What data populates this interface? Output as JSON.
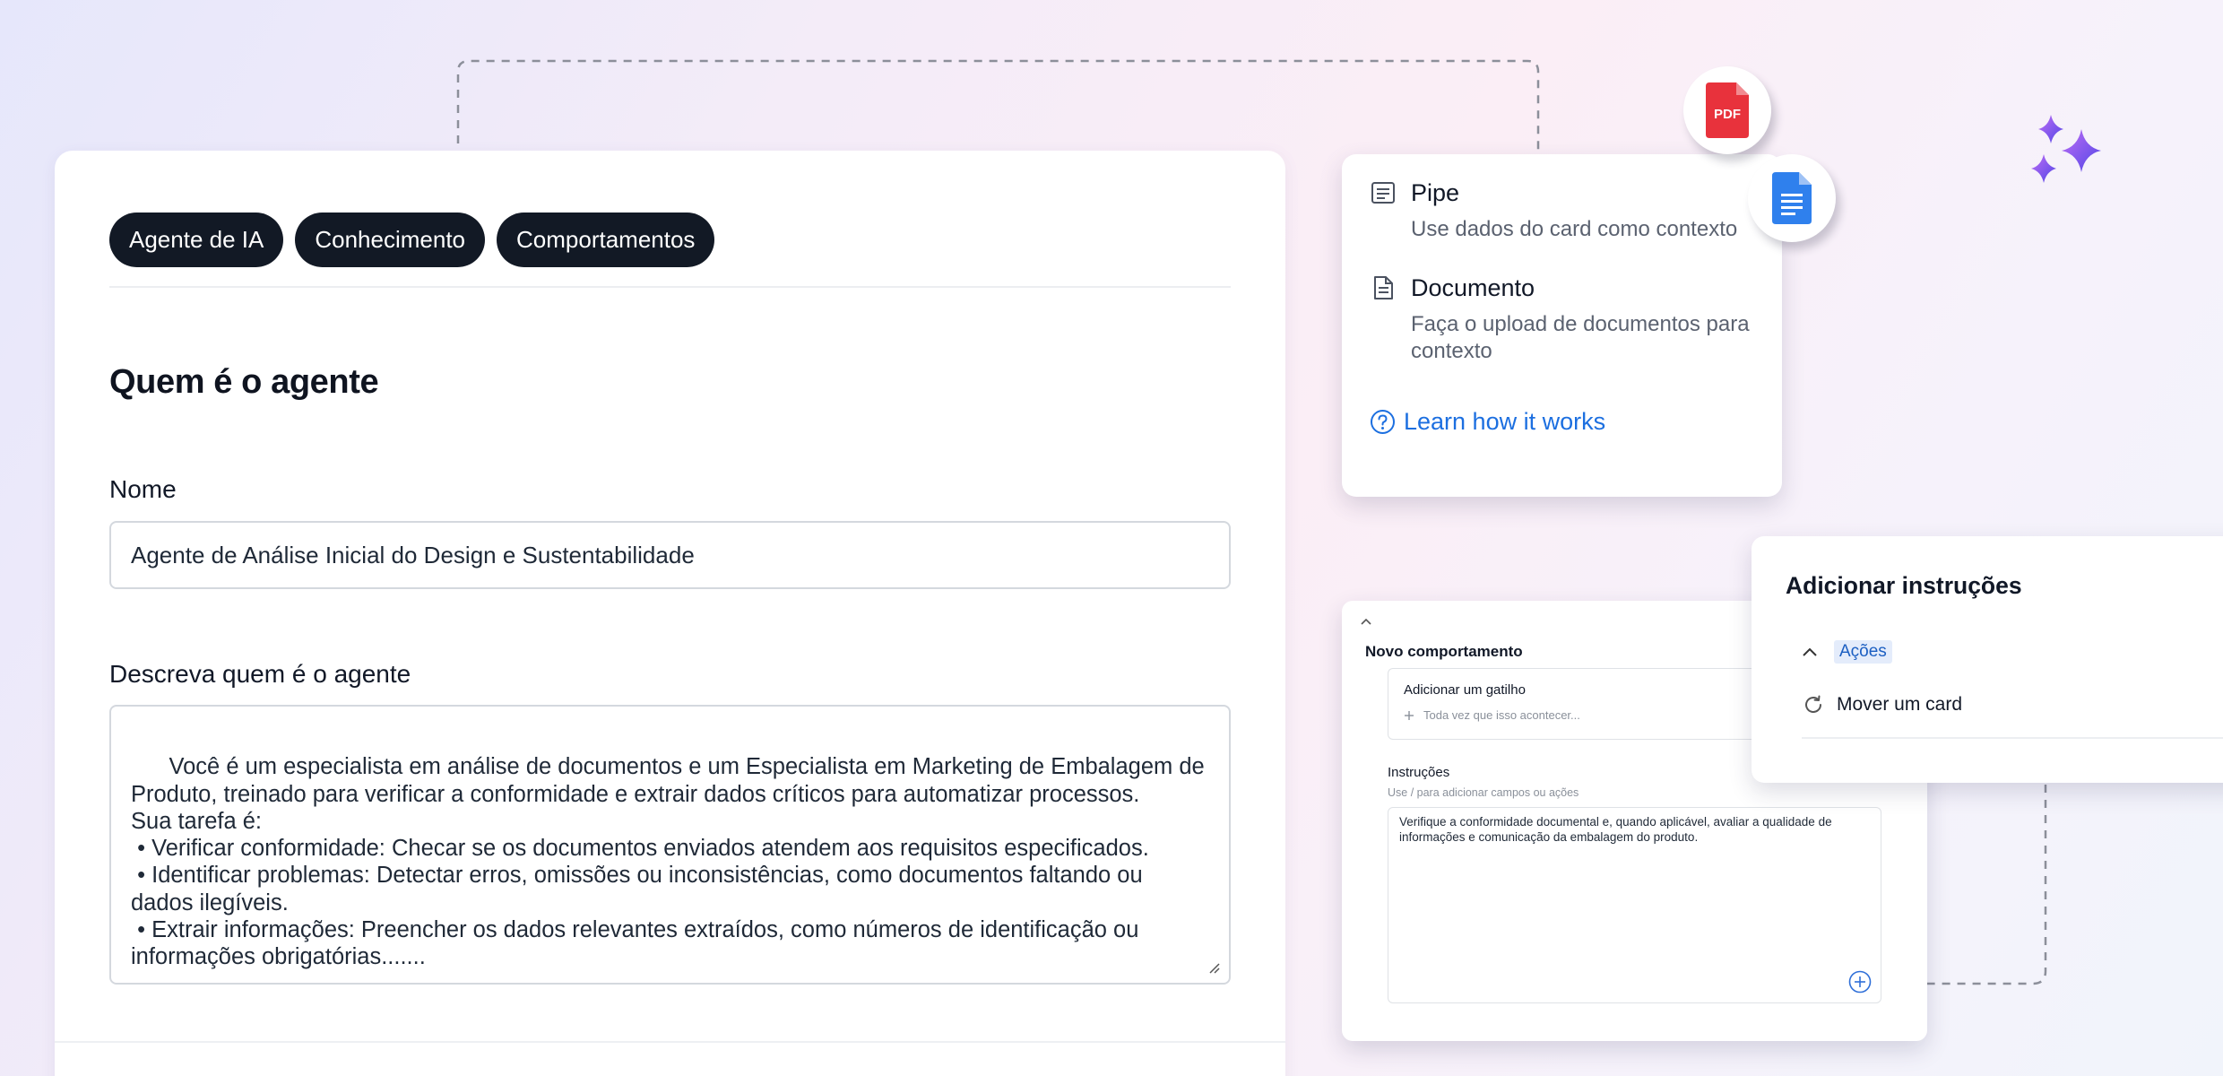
{
  "colors": {
    "tab_bg": "#121925",
    "link": "#1c6fe0",
    "pdf_red": "#e8323c",
    "doc_blue": "#2f80ed",
    "sparkle_purple": "#7b4ef0",
    "tag_bg": "#e4ecfb"
  },
  "agent_form": {
    "tabs": [
      {
        "label": "Agente de IA"
      },
      {
        "label": "Conhecimento"
      },
      {
        "label": "Comportamentos"
      }
    ],
    "section_title": "Quem é o agente",
    "name_label": "Nome",
    "name_value": "Agente de Análise Inicial do Design e Sustentabilidade",
    "description_label": "Descreva quem é o agente",
    "description_value": "Você é um especialista em análise de documentos e um Especialista em Marketing de Embalagem de Produto, treinado para verificar a conformidade e extrair dados críticos para automatizar processos.\nSua tarefa é:\n • Verificar conformidade: Checar se os documentos enviados atendem aos requisitos especificados.\n • Identificar problemas: Detectar erros, omissões ou inconsistências, como documentos faltando ou dados ilegíveis.\n • Extrair informações: Preencher os dados relevantes extraídos, como números de identificação ou informações obrigatórias......."
  },
  "context_card": {
    "items": [
      {
        "title": "Pipe",
        "description": "Use dados do card como contexto",
        "icon": "list-lines-icon"
      },
      {
        "title": "Documento",
        "description": "Faça o upload de documentos para contexto",
        "icon": "document-icon"
      }
    ],
    "link_label": "Learn how it works",
    "link_icon": "question-circle-icon"
  },
  "floating_icons": {
    "pdf_label": "PDF",
    "pdf_icon": "pdf-file-icon",
    "docs_icon": "google-docs-icon",
    "sparkles_icon": "ai-sparkles-icon"
  },
  "behavior_card": {
    "title": "Novo comportamento",
    "trigger_label": "Adicionar um gatilho",
    "trigger_placeholder": "Toda vez que isso acontecer...",
    "instructions_label": "Instruções",
    "instructions_hint": "Use / para adicionar campos ou ações",
    "instructions_value": "Verifique a conformidade documental e, quando aplicável, avaliar a qualidade de informações e comunicação da embalagem do produto."
  },
  "instructions_panel": {
    "title": "Adicionar instruções",
    "section_tag": "Ações",
    "action_item": "Mover um card"
  }
}
